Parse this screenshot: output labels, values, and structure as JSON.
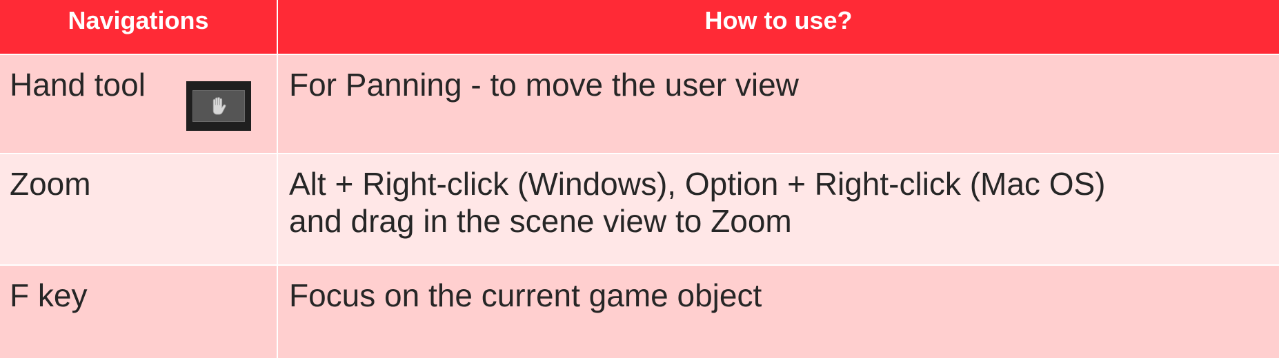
{
  "header": {
    "col1": "Navigations",
    "col2": "How to use?"
  },
  "rows": [
    {
      "name": "Hand tool",
      "icon": "hand-icon",
      "description": [
        "For Panning  - to move the user view"
      ]
    },
    {
      "name": "Zoom",
      "description": [
        "Alt + Right-click (Windows), Option + Right-click (Mac OS)",
        "and drag in the scene view to Zoom"
      ]
    },
    {
      "name": "F key",
      "description": [
        "Focus on the current game object"
      ]
    }
  ],
  "colors": {
    "header_bg": "#ff2a36",
    "row_odd_bg": "#ffcfcf",
    "row_even_bg": "#ffe7e7",
    "text": "#262626"
  }
}
